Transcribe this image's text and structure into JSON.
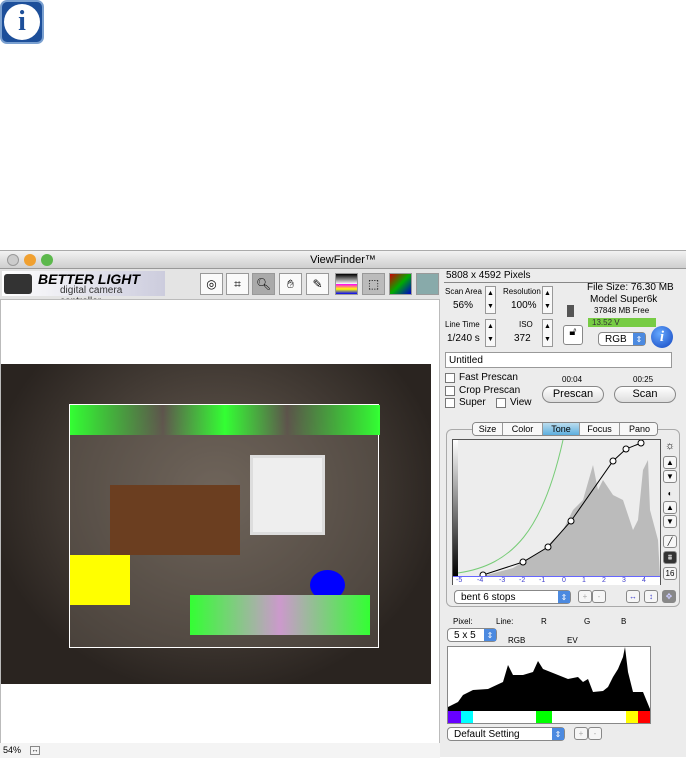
{
  "window": {
    "title": "ViewFinder™"
  },
  "logo": {
    "brand": "BETTER LIGHT",
    "tagline": "digital camera controller"
  },
  "status": {
    "zoom": "54%"
  },
  "panel": {
    "pixels": "5808 x 4592 Pixels",
    "scan_area": {
      "label": "Scan Area",
      "value": "56%"
    },
    "resolution": {
      "label": "Resolution",
      "value": "100%"
    },
    "line_time": {
      "label": "Line Time",
      "value": "1/240 s"
    },
    "iso": {
      "label": "ISO",
      "value": "372"
    },
    "file_size": "File Size: 76.30 MB",
    "model": "Model Super6k",
    "free": "37848 MB Free",
    "voltage": "13.52 V",
    "color_mode": "RGB",
    "filename": "Untitled",
    "fast_prescan": "Fast Prescan",
    "crop_prescan": "Crop Prescan",
    "super": "Super",
    "view": "View",
    "prescan_time": "00:04",
    "scan_time": "00:25",
    "prescan": "Prescan",
    "scan": "Scan",
    "tabs": [
      "Size",
      "Color",
      "Tone",
      "Focus",
      "Pano"
    ],
    "active_tab": "Tone",
    "ev_ticks": [
      "-5",
      "-4",
      "-3",
      "-2",
      "-1",
      "0",
      "1",
      "2",
      "3",
      "4"
    ],
    "tone_preset": "bent 6 stops",
    "side_16": "16",
    "readout": {
      "pixel": "Pixel:",
      "line": "Line:",
      "r": "R",
      "g": "G",
      "b": "B",
      "rgb": "RGB",
      "ev": "EV"
    },
    "sample_size": "5 x 5",
    "setting": "Default Setting",
    "plus": "+",
    "minus": "-"
  }
}
